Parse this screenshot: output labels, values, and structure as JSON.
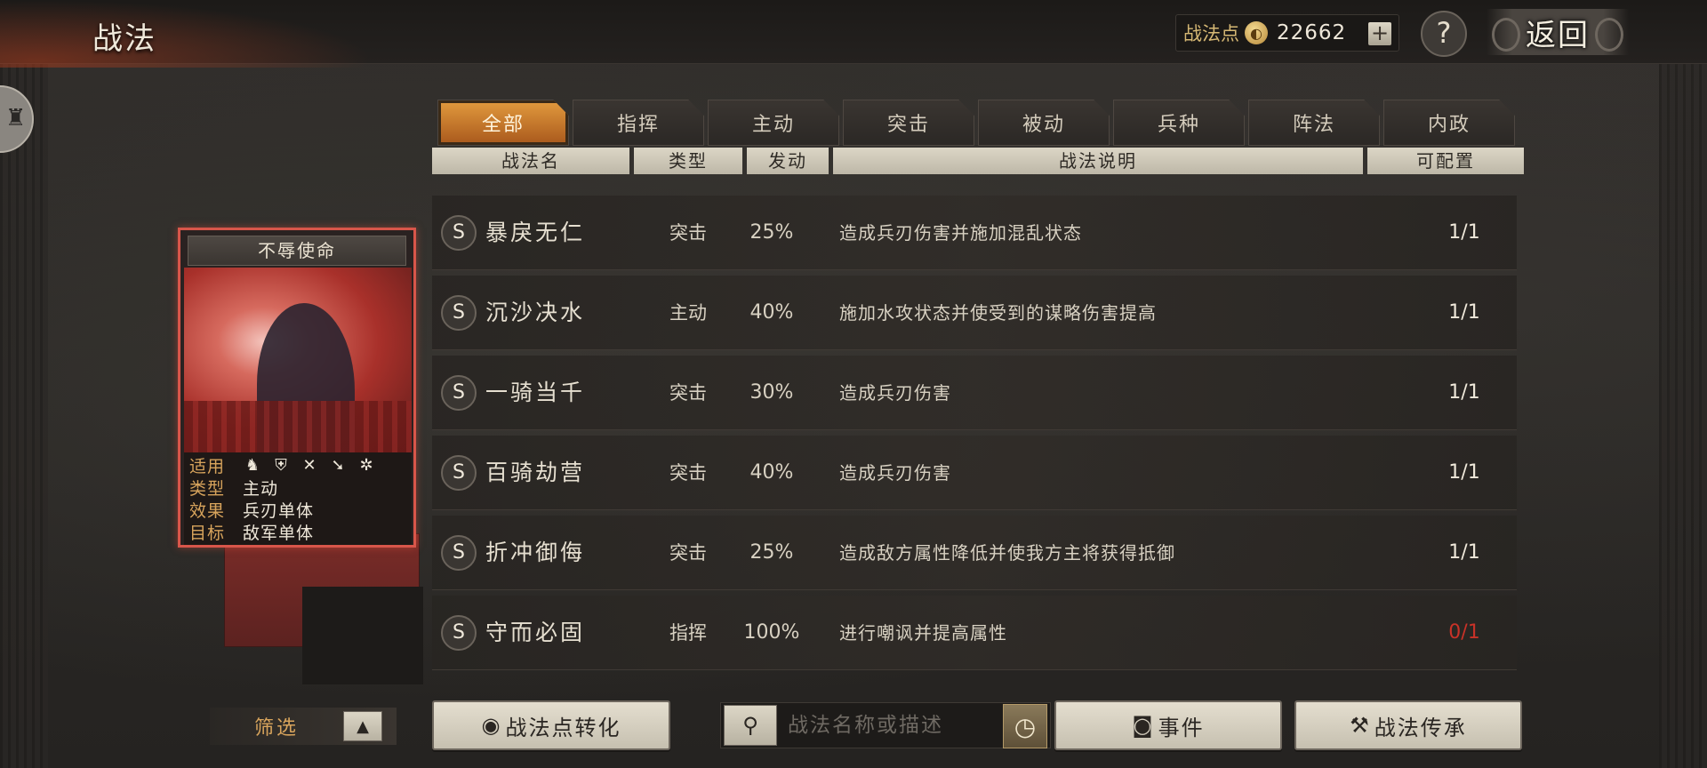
{
  "header": {
    "title": "战法",
    "points_label": "战法点",
    "points_value": "22662",
    "plus": "+",
    "help": "?",
    "back_label": "返回"
  },
  "card": {
    "title": "不辱使命",
    "rows": [
      {
        "key": "适用",
        "val": ""
      },
      {
        "key": "类型",
        "val": "主动"
      },
      {
        "key": "效果",
        "val": "兵刃单体"
      },
      {
        "key": "目标",
        "val": "敌军单体"
      }
    ],
    "unit_icons": [
      "cavalry-icon",
      "shield-icon",
      "bow-icon",
      "spear-icon",
      "wheel-icon"
    ]
  },
  "tabs": [
    {
      "label": "全部",
      "active": true
    },
    {
      "label": "指挥",
      "active": false
    },
    {
      "label": "主动",
      "active": false
    },
    {
      "label": "突击",
      "active": false
    },
    {
      "label": "被动",
      "active": false
    },
    {
      "label": "兵种",
      "active": false
    },
    {
      "label": "阵法",
      "active": false
    },
    {
      "label": "内政",
      "active": false
    }
  ],
  "columns": [
    "战法名",
    "类型",
    "发动",
    "战法说明",
    "可配置"
  ],
  "rows": [
    {
      "grade": "S",
      "name": "暴戾无仁",
      "type": "突击",
      "rate": "25%",
      "desc": "造成兵刃伤害并施加混乱状态",
      "count": "1/1",
      "count_color": "#efe8da"
    },
    {
      "grade": "S",
      "name": "沉沙决水",
      "type": "主动",
      "rate": "40%",
      "desc": "施加水攻状态并使受到的谋略伤害提高",
      "count": "1/1",
      "count_color": "#efe8da"
    },
    {
      "grade": "S",
      "name": "一骑当千",
      "type": "突击",
      "rate": "30%",
      "desc": "造成兵刃伤害",
      "count": "1/1",
      "count_color": "#efe8da"
    },
    {
      "grade": "S",
      "name": "百骑劫营",
      "type": "突击",
      "rate": "40%",
      "desc": "造成兵刃伤害",
      "count": "1/1",
      "count_color": "#efe8da"
    },
    {
      "grade": "S",
      "name": "折冲御侮",
      "type": "突击",
      "rate": "25%",
      "desc": "造成敌方属性降低并使我方主将获得抵御",
      "count": "1/1",
      "count_color": "#efe8da"
    },
    {
      "grade": "S",
      "name": "守而必固",
      "type": "指挥",
      "rate": "100%",
      "desc": "进行嘲讽并提高属性",
      "count": "0/1",
      "count_color": "#c83228"
    }
  ],
  "footer": {
    "filter_label": "筛选",
    "convert_label": "战法点转化",
    "search_placeholder": "战法名称或描述",
    "event_label": "事件",
    "inherit_label": "战法传承"
  }
}
